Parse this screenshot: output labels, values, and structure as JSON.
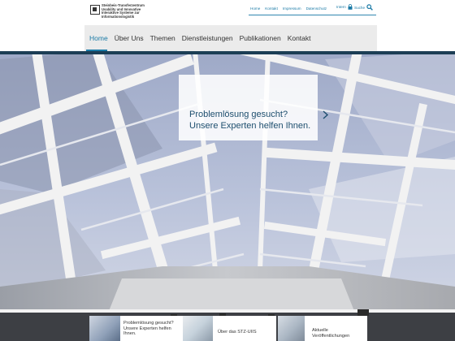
{
  "logo": {
    "lines": [
      "Steinbeis-Transferzentrum",
      "Usability und Innovative",
      "Interaktive Systeme zur",
      "Informationslogistik"
    ],
    "icon": "steinbeis-logo-mark"
  },
  "utility_nav": {
    "links": [
      "Home",
      "Kontakt",
      "Impressum",
      "Datenschutz"
    ],
    "intern_label": "Intern",
    "search_label": "Suche"
  },
  "main_nav": {
    "items": [
      "Home",
      "Über Uns",
      "Themen",
      "Dienstleistungen",
      "Publikationen",
      "Kontakt"
    ],
    "active_index": 0
  },
  "hero": {
    "callout": "Problemlösung gesucht? Unsere Experten helfen Ihnen."
  },
  "teasers": [
    {
      "text": "Problemlösung gesucht? Unsere Experten helfen Ihnen."
    },
    {
      "text": "Über das STZ-UIIS"
    },
    {
      "text": "Aktuelle Veröffentlichungen"
    }
  ],
  "colors": {
    "accent": "#1a7aa6",
    "callout_text": "#1d4e6e",
    "nav_bg": "#ebebeb",
    "hero_top_band": "#1c3e55"
  }
}
